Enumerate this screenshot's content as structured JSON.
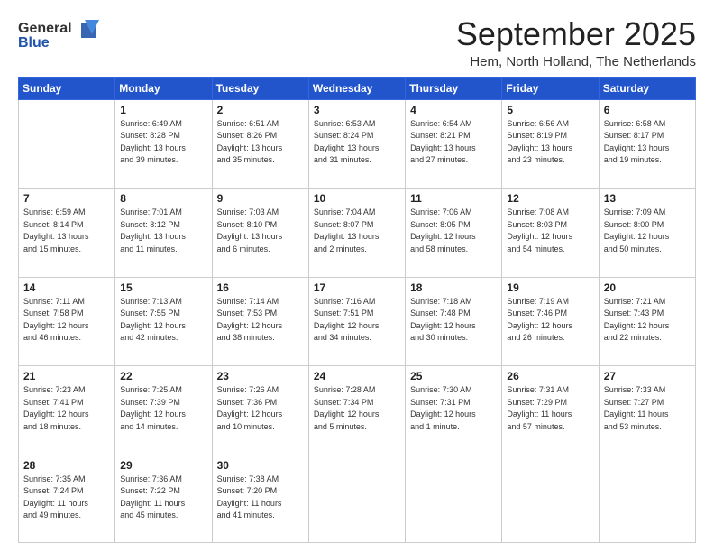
{
  "header": {
    "logo_general": "General",
    "logo_blue": "Blue",
    "month": "September 2025",
    "location": "Hem, North Holland, The Netherlands"
  },
  "weekdays": [
    "Sunday",
    "Monday",
    "Tuesday",
    "Wednesday",
    "Thursday",
    "Friday",
    "Saturday"
  ],
  "days": [
    {
      "date": "",
      "sunrise": "",
      "sunset": "",
      "daylight": ""
    },
    {
      "date": "1",
      "sunrise": "6:49 AM",
      "sunset": "8:28 PM",
      "daylight": "13 hours and 39 minutes."
    },
    {
      "date": "2",
      "sunrise": "6:51 AM",
      "sunset": "8:26 PM",
      "daylight": "13 hours and 35 minutes."
    },
    {
      "date": "3",
      "sunrise": "6:53 AM",
      "sunset": "8:24 PM",
      "daylight": "13 hours and 31 minutes."
    },
    {
      "date": "4",
      "sunrise": "6:54 AM",
      "sunset": "8:21 PM",
      "daylight": "13 hours and 27 minutes."
    },
    {
      "date": "5",
      "sunrise": "6:56 AM",
      "sunset": "8:19 PM",
      "daylight": "13 hours and 23 minutes."
    },
    {
      "date": "6",
      "sunrise": "6:58 AM",
      "sunset": "8:17 PM",
      "daylight": "13 hours and 19 minutes."
    },
    {
      "date": "7",
      "sunrise": "6:59 AM",
      "sunset": "8:14 PM",
      "daylight": "13 hours and 15 minutes."
    },
    {
      "date": "8",
      "sunrise": "7:01 AM",
      "sunset": "8:12 PM",
      "daylight": "13 hours and 11 minutes."
    },
    {
      "date": "9",
      "sunrise": "7:03 AM",
      "sunset": "8:10 PM",
      "daylight": "13 hours and 6 minutes."
    },
    {
      "date": "10",
      "sunrise": "7:04 AM",
      "sunset": "8:07 PM",
      "daylight": "13 hours and 2 minutes."
    },
    {
      "date": "11",
      "sunrise": "7:06 AM",
      "sunset": "8:05 PM",
      "daylight": "12 hours and 58 minutes."
    },
    {
      "date": "12",
      "sunrise": "7:08 AM",
      "sunset": "8:03 PM",
      "daylight": "12 hours and 54 minutes."
    },
    {
      "date": "13",
      "sunrise": "7:09 AM",
      "sunset": "8:00 PM",
      "daylight": "12 hours and 50 minutes."
    },
    {
      "date": "14",
      "sunrise": "7:11 AM",
      "sunset": "7:58 PM",
      "daylight": "12 hours and 46 minutes."
    },
    {
      "date": "15",
      "sunrise": "7:13 AM",
      "sunset": "7:55 PM",
      "daylight": "12 hours and 42 minutes."
    },
    {
      "date": "16",
      "sunrise": "7:14 AM",
      "sunset": "7:53 PM",
      "daylight": "12 hours and 38 minutes."
    },
    {
      "date": "17",
      "sunrise": "7:16 AM",
      "sunset": "7:51 PM",
      "daylight": "12 hours and 34 minutes."
    },
    {
      "date": "18",
      "sunrise": "7:18 AM",
      "sunset": "7:48 PM",
      "daylight": "12 hours and 30 minutes."
    },
    {
      "date": "19",
      "sunrise": "7:19 AM",
      "sunset": "7:46 PM",
      "daylight": "12 hours and 26 minutes."
    },
    {
      "date": "20",
      "sunrise": "7:21 AM",
      "sunset": "7:43 PM",
      "daylight": "12 hours and 22 minutes."
    },
    {
      "date": "21",
      "sunrise": "7:23 AM",
      "sunset": "7:41 PM",
      "daylight": "12 hours and 18 minutes."
    },
    {
      "date": "22",
      "sunrise": "7:25 AM",
      "sunset": "7:39 PM",
      "daylight": "12 hours and 14 minutes."
    },
    {
      "date": "23",
      "sunrise": "7:26 AM",
      "sunset": "7:36 PM",
      "daylight": "12 hours and 10 minutes."
    },
    {
      "date": "24",
      "sunrise": "7:28 AM",
      "sunset": "7:34 PM",
      "daylight": "12 hours and 5 minutes."
    },
    {
      "date": "25",
      "sunrise": "7:30 AM",
      "sunset": "7:31 PM",
      "daylight": "12 hours and 1 minute."
    },
    {
      "date": "26",
      "sunrise": "7:31 AM",
      "sunset": "7:29 PM",
      "daylight": "11 hours and 57 minutes."
    },
    {
      "date": "27",
      "sunrise": "7:33 AM",
      "sunset": "7:27 PM",
      "daylight": "11 hours and 53 minutes."
    },
    {
      "date": "28",
      "sunrise": "7:35 AM",
      "sunset": "7:24 PM",
      "daylight": "11 hours and 49 minutes."
    },
    {
      "date": "29",
      "sunrise": "7:36 AM",
      "sunset": "7:22 PM",
      "daylight": "11 hours and 45 minutes."
    },
    {
      "date": "30",
      "sunrise": "7:38 AM",
      "sunset": "7:20 PM",
      "daylight": "11 hours and 41 minutes."
    }
  ]
}
